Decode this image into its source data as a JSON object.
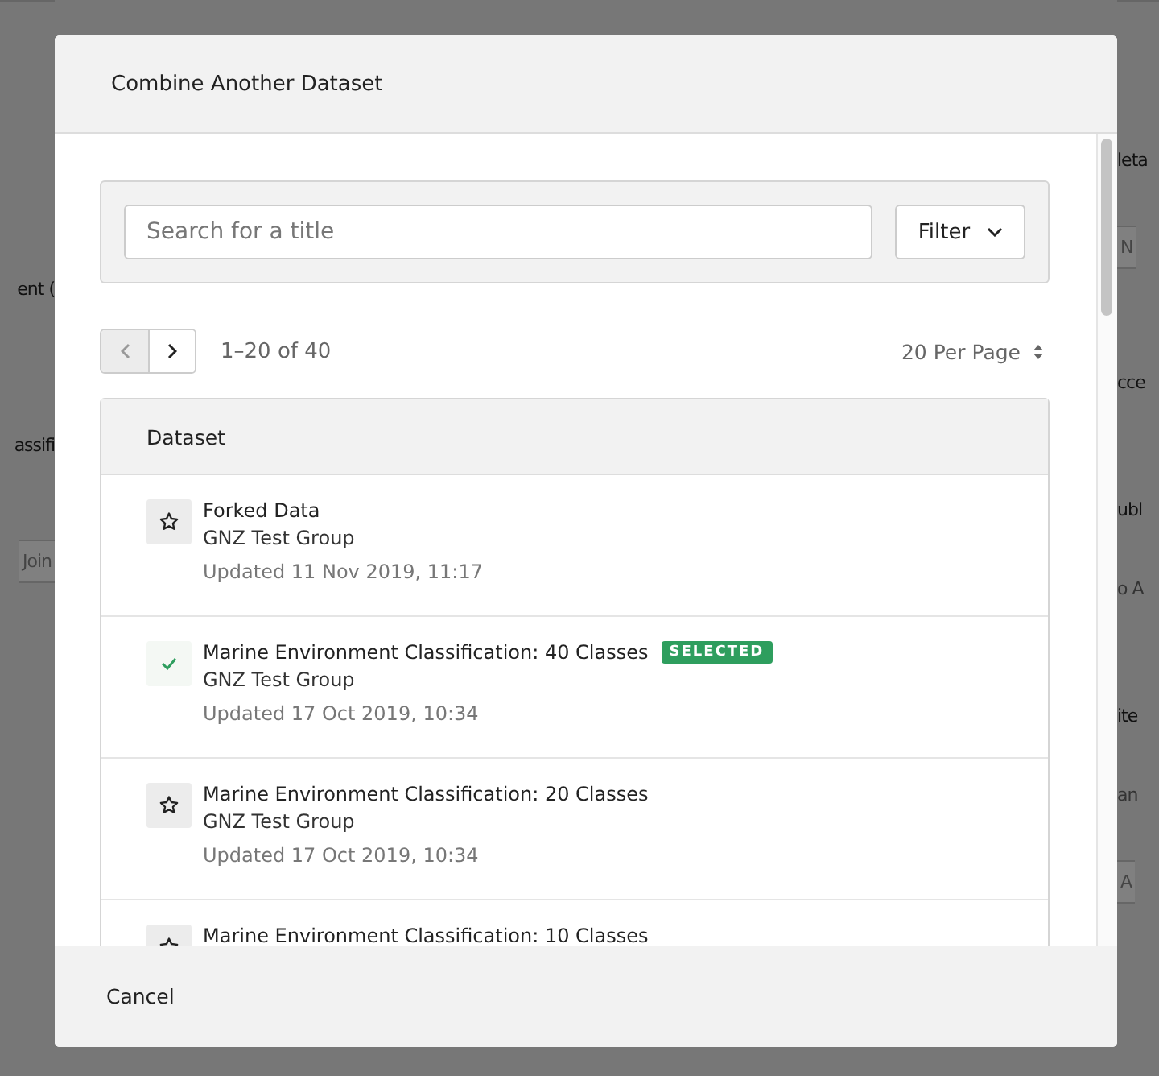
{
  "background": {
    "left_fragments": [
      {
        "text": "ent (",
        "kind": "text"
      },
      {
        "text": "assifi",
        "kind": "text"
      },
      {
        "text": "Join",
        "kind": "field"
      }
    ],
    "right_fragments": [
      {
        "text": "leta",
        "kind": "text"
      },
      {
        "text": "N",
        "kind": "field"
      },
      {
        "text": "cce",
        "kind": "text"
      },
      {
        "text": "ubl",
        "kind": "text"
      },
      {
        "text": "o A",
        "kind": "muted"
      },
      {
        "text": "ite",
        "kind": "text"
      },
      {
        "text": "an",
        "kind": "muted"
      },
      {
        "text": "A",
        "kind": "field"
      }
    ]
  },
  "dialog": {
    "title": "Combine Another Dataset",
    "search": {
      "placeholder": "Search for a title"
    },
    "filter_button": "Filter",
    "pagination": {
      "prev_disabled": true,
      "range": "1–20 of 40",
      "per_page": "20 Per Page"
    },
    "table": {
      "column": "Dataset",
      "rows": [
        {
          "title": "Forked Data",
          "group": "GNZ Test Group",
          "updated": "Updated 11 Nov 2019, 11:17",
          "selected": false
        },
        {
          "title": "Marine Environment Classification: 40 Classes",
          "group": "GNZ Test Group",
          "updated": "Updated 17 Oct 2019, 10:34",
          "selected": true,
          "badge": "SELECTED"
        },
        {
          "title": "Marine Environment Classification: 20 Classes",
          "group": "GNZ Test Group",
          "updated": "Updated 17 Oct 2019, 10:34",
          "selected": false
        },
        {
          "title": "Marine Environment Classification: 10 Classes",
          "selected": false
        }
      ]
    },
    "footer_button": "Cancel"
  }
}
